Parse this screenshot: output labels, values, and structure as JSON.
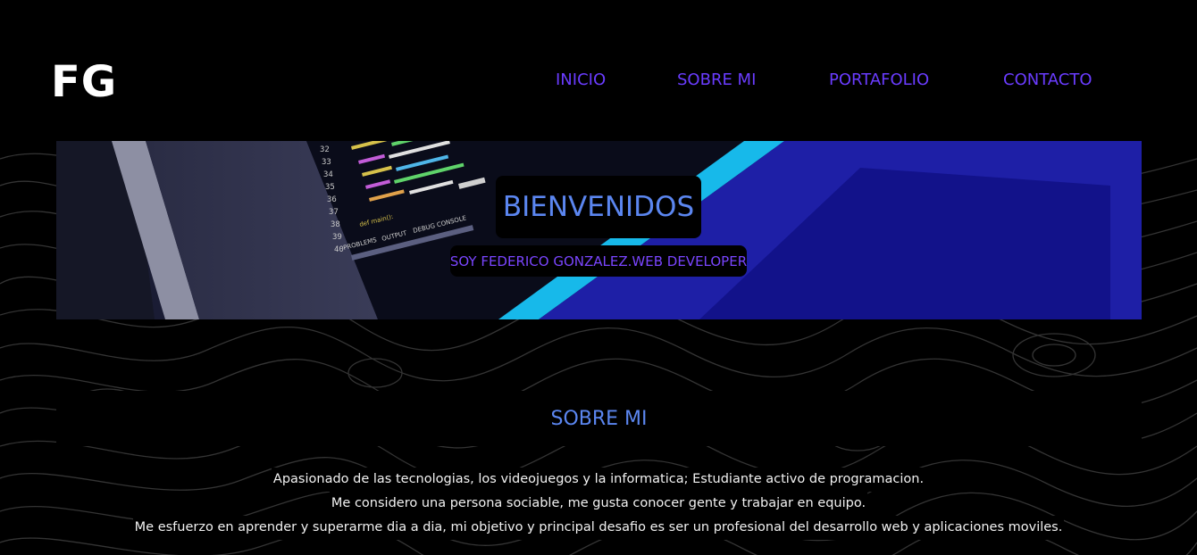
{
  "header": {
    "logo": "FG",
    "nav": [
      {
        "label": "INICIO"
      },
      {
        "label": "SOBRE MI"
      },
      {
        "label": "PORTAFOLIO"
      },
      {
        "label": "CONTACTO"
      }
    ]
  },
  "hero": {
    "title": "BIENVENIDOS",
    "subtitle": "SOY FEDERICO GONZALEZ.WEB DEVELOPER",
    "code_lines": [
      "32",
      "33",
      "34",
      "35",
      "36",
      "37",
      "38",
      "39",
      "40"
    ],
    "code_bar": [
      "PROBLEMS",
      "OUTPUT",
      "DEBUG CONSOLE"
    ],
    "code_def": "def main():"
  },
  "about": {
    "title": "SOBRE MI",
    "lines": [
      "Apasionado de las tecnologias, los videojuegos y la informatica; Estudiante activo de programacion.",
      "Me considero una persona sociable, me gusta conocer gente y trabajar en equipo.",
      "Me esfuerzo en aprender y superarme dia a dia, mi objetivo y principal desafio es ser un profesional del desarrollo web y aplicaciones moviles."
    ]
  },
  "colors": {
    "background": "#000000",
    "nav_link": "#6a3cff",
    "heading": "#5b86f0",
    "subtitle": "#7a45ff",
    "text": "#f2f2f2"
  }
}
